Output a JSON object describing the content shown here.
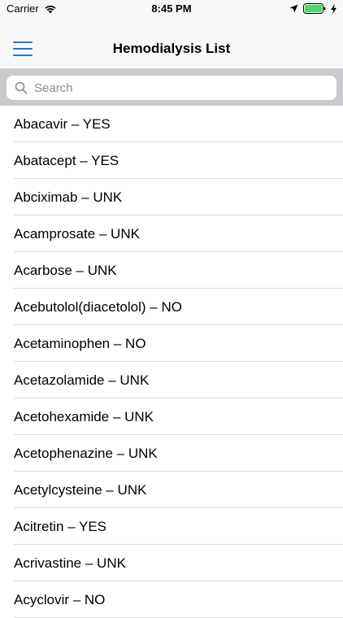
{
  "status_bar": {
    "carrier": "Carrier",
    "time": "8:45 PM"
  },
  "nav": {
    "title": "Hemodialysis List",
    "menu_icon": "hamburger-menu-icon",
    "accent_color": "#2f6fd9"
  },
  "search": {
    "placeholder": "Search",
    "value": "",
    "icon": "search-icon"
  },
  "list": {
    "items": [
      "Abacavir – YES",
      "Abatacept – YES",
      "Abciximab – UNK",
      "Acamprosate – UNK",
      "Acarbose – UNK",
      "Acebutolol(diacetolol) – NO",
      "Acetaminophen – NO",
      "Acetazolamide – UNK",
      "Acetohexamide – UNK",
      "Acetophenazine – UNK",
      "Acetylcysteine – UNK",
      "Acitretin – YES",
      "Acrivastine – UNK",
      "Acyclovir – NO"
    ]
  }
}
